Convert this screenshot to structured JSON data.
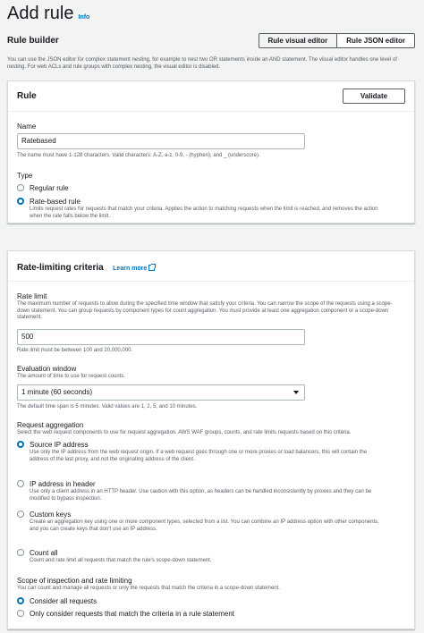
{
  "header": {
    "title": "Add rule",
    "info": "Info"
  },
  "rule_builder": {
    "title": "Rule builder",
    "tabs": [
      {
        "label": "Rule visual editor",
        "active": true
      },
      {
        "label": "Rule JSON editor",
        "active": false
      }
    ],
    "help": "You can use the JSON editor for complex statement nesting, for example to nest two OR statements inside an AND statement. The visual editor handles one level of nesting. For web ACLs and rule groups with complex nesting, the visual editor is disabled."
  },
  "rule_panel": {
    "title": "Rule",
    "validate_label": "Validate",
    "name_label": "Name",
    "name_value": "Ratebased",
    "name_help": "The name must have 1-128 characters. Valid characters: A-Z, a-z, 0-9, - (hyphen), and _ (underscore).",
    "type_label": "Type",
    "type_options": [
      {
        "label": "Regular rule",
        "selected": false,
        "desc": ""
      },
      {
        "label": "Rate-based rule",
        "selected": true,
        "desc": "Limits request rates for requests that match your criteria. Applies the action to matching requests when the limit is reached, and removes the action when the rate falls below the limit."
      }
    ]
  },
  "rate_panel": {
    "title": "Rate-limiting criteria",
    "learn_more": "Learn more",
    "rate_limit_label": "Rate limit",
    "rate_limit_desc": "The maximum number of requests to allow during the specified time window that satisfy your criteria. You can narrow the scope of the requests using a scope-down statement. You can group requests by component types for count aggregation. You must provide at least one aggregation component or a scope-down statement.",
    "rate_limit_value": "500",
    "rate_limit_help": "Rate limit must be between 100 and 20,000,000.",
    "eval_label": "Evaluation window",
    "eval_desc": "The amount of time to use for request counts.",
    "eval_value": "1 minute (60 seconds)",
    "eval_help": "The default time span is 5 minutes. Valid values are 1, 2, 5, and 10 minutes.",
    "agg_label": "Request aggregation",
    "agg_desc": "Select the web request components to use for request aggregation. AWS WAF groups, counts, and rate limits requests based on this criteria.",
    "agg_options": [
      {
        "label": "Source IP address",
        "selected": true,
        "desc": "Use only the IP address from the web request origin. If a web request goes through one or more proxies or load balancers, this will contain the address of the last proxy, and not the originating address of the client."
      },
      {
        "label": "IP address in header",
        "selected": false,
        "desc": "Use only a client address in an HTTP header. Use caution with this option, as headers can be handled inconsistently by proxies and they can be modified to bypass inspection."
      },
      {
        "label": "Custom keys",
        "selected": false,
        "desc": "Create an aggregation key using one or more component types, selected from a list. You can combine an IP address option with other components, and you can create keys that don't use an IP address."
      },
      {
        "label": "Count all",
        "selected": false,
        "desc": "Count and rate limit all requests that match the rule's scope-down statement."
      }
    ],
    "scope_label": "Scope of inspection and rate limiting",
    "scope_desc": "You can count and manage all requests or only the requests that match the criteria in a scope-down statement.",
    "scope_options": [
      {
        "label": "Consider all requests",
        "selected": true
      },
      {
        "label": "Only consider requests that match the criteria in a rule statement",
        "selected": false
      }
    ]
  }
}
